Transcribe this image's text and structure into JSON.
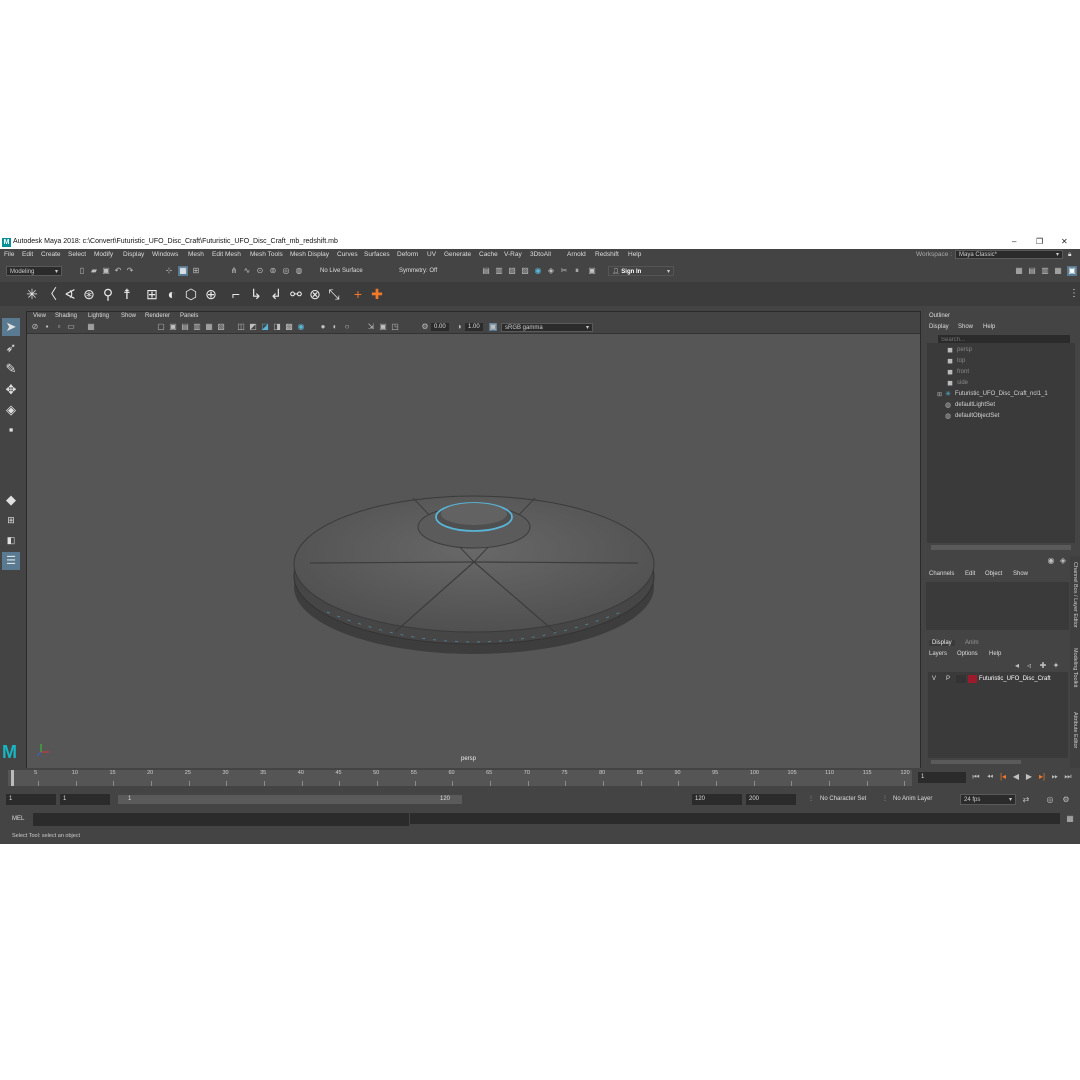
{
  "window": {
    "title": "Autodesk Maya 2018: c:\\Convert\\Futuristic_UFO_Disc_Craft\\Futuristic_UFO_Disc_Craft_mb_redshift.mb",
    "logo": "M",
    "minimize": "–",
    "maximize": "❐",
    "close": "✕"
  },
  "menubar": {
    "items": [
      "File",
      "Edit",
      "Create",
      "Select",
      "Modify",
      "Display",
      "Windows",
      "Mesh",
      "Edit Mesh",
      "Mesh Tools",
      "Mesh Display",
      "Curves",
      "Surfaces",
      "Deform",
      "UV",
      "Generate",
      "Cache",
      "V-Ray",
      "3DtoAll",
      "Arnold",
      "Redshift",
      "Help"
    ],
    "workspace_label": "Workspace :",
    "workspace_value": "Maya Classic*"
  },
  "statusline": {
    "mode": "Modeling",
    "live_surface": "No Live Surface",
    "symmetry": "Symmetry: Off",
    "sign_in": "Sign In"
  },
  "viewport": {
    "menus": [
      "View",
      "Shading",
      "Lighting",
      "Show",
      "Renderer",
      "Panels"
    ],
    "exposure": "0.00",
    "gamma": "1.00",
    "color_space": "sRGB gamma",
    "camera": "persp",
    "maya_logo": "M"
  },
  "outliner": {
    "title": "Outliner",
    "menus": [
      "Display",
      "Show",
      "Help"
    ],
    "search_placeholder": "Search...",
    "items": [
      {
        "label": "persp",
        "icon": "camera-icon",
        "dim": true
      },
      {
        "label": "top",
        "icon": "camera-icon",
        "dim": true
      },
      {
        "label": "front",
        "icon": "camera-icon",
        "dim": true
      },
      {
        "label": "side",
        "icon": "camera-icon",
        "dim": true
      },
      {
        "label": "Futuristic_UFO_Disc_Craft_ncl1_1",
        "icon": "group-icon",
        "dim": false
      },
      {
        "label": "defaultLightSet",
        "icon": "set-icon",
        "dim": false
      },
      {
        "label": "defaultObjectSet",
        "icon": "set-icon",
        "dim": false
      }
    ]
  },
  "channelbox": {
    "menus": [
      "Channels",
      "Edit",
      "Object",
      "Show"
    ]
  },
  "layers": {
    "tabs": [
      "Display",
      "Anim"
    ],
    "menus": [
      "Layers",
      "Options",
      "Help"
    ],
    "row": {
      "v": "V",
      "p": "P",
      "name": "Futuristic_UFO_Disc_Craft",
      "color": "#9c1a2c"
    }
  },
  "side_tabs": [
    "Channel Box / Layer Editor",
    "Modeling Toolkit",
    "Attribute Editor"
  ],
  "timeslider": {
    "ticks": [
      "5",
      "10",
      "15",
      "20",
      "25",
      "30",
      "35",
      "40",
      "45",
      "50",
      "55",
      "60",
      "65",
      "70",
      "75",
      "80",
      "85",
      "90",
      "95",
      "100",
      "105",
      "110",
      "115",
      "120"
    ],
    "current_frame": "1"
  },
  "range": {
    "start": "1",
    "playback_start": "1",
    "slider_start": "1",
    "slider_end": "120",
    "playback_end": "120",
    "end": "200",
    "character_set": "No Character Set",
    "anim_layer": "No Anim Layer",
    "fps": "24 fps"
  },
  "commandline": {
    "label": "MEL"
  },
  "helpline": {
    "text": "Select Tool: select an object"
  },
  "colors": {
    "ui_bg": "#444444",
    "viewport_bg": "#565656",
    "accent": "#5ab4d6",
    "layer_color": "#9c1a2c"
  }
}
